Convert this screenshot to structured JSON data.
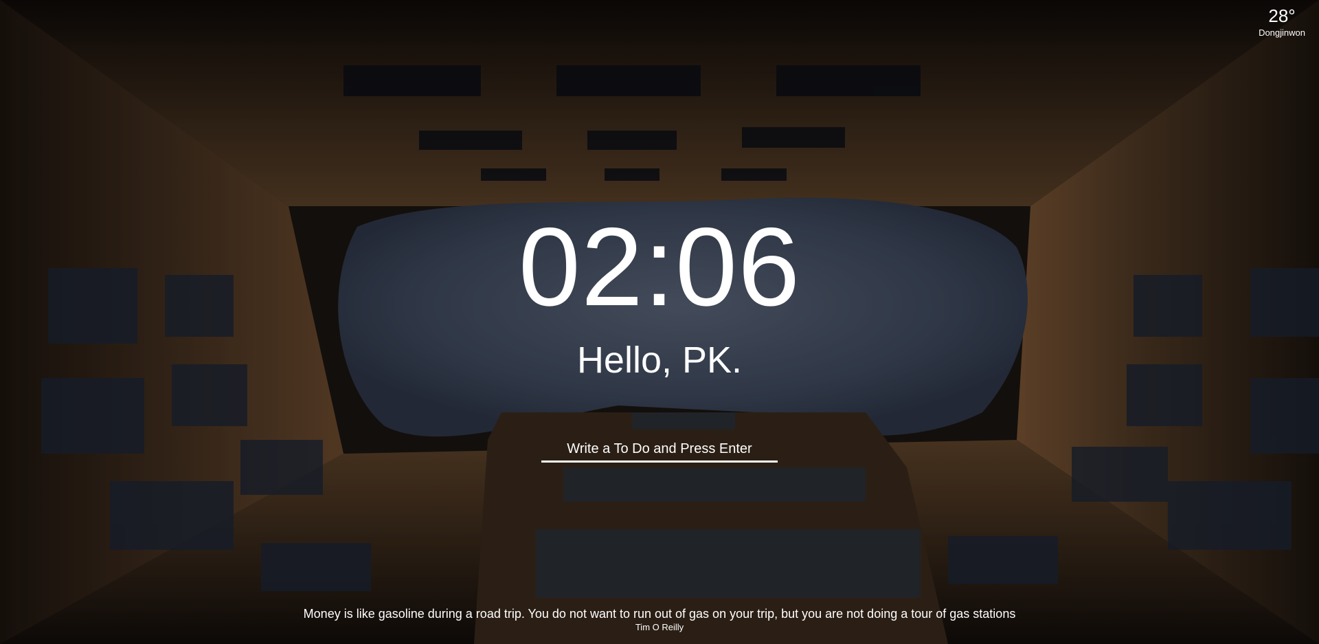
{
  "weather": {
    "temperature": "28°",
    "location": "Dongjinwon"
  },
  "clock": {
    "time": "02:06"
  },
  "greeting": {
    "text": "Hello, PK."
  },
  "todo": {
    "placeholder": "Write a To Do and Press Enter",
    "value": ""
  },
  "quote": {
    "text": "Money is like gasoline during a road trip. You do not want to run out of gas on your trip, but you are not doing a tour of gas stations",
    "author": "Tim O Reilly"
  },
  "background": {
    "description_icon": "courtyard-photo",
    "sky_color": "#4a5468",
    "building_color": "#6b4a2e"
  }
}
